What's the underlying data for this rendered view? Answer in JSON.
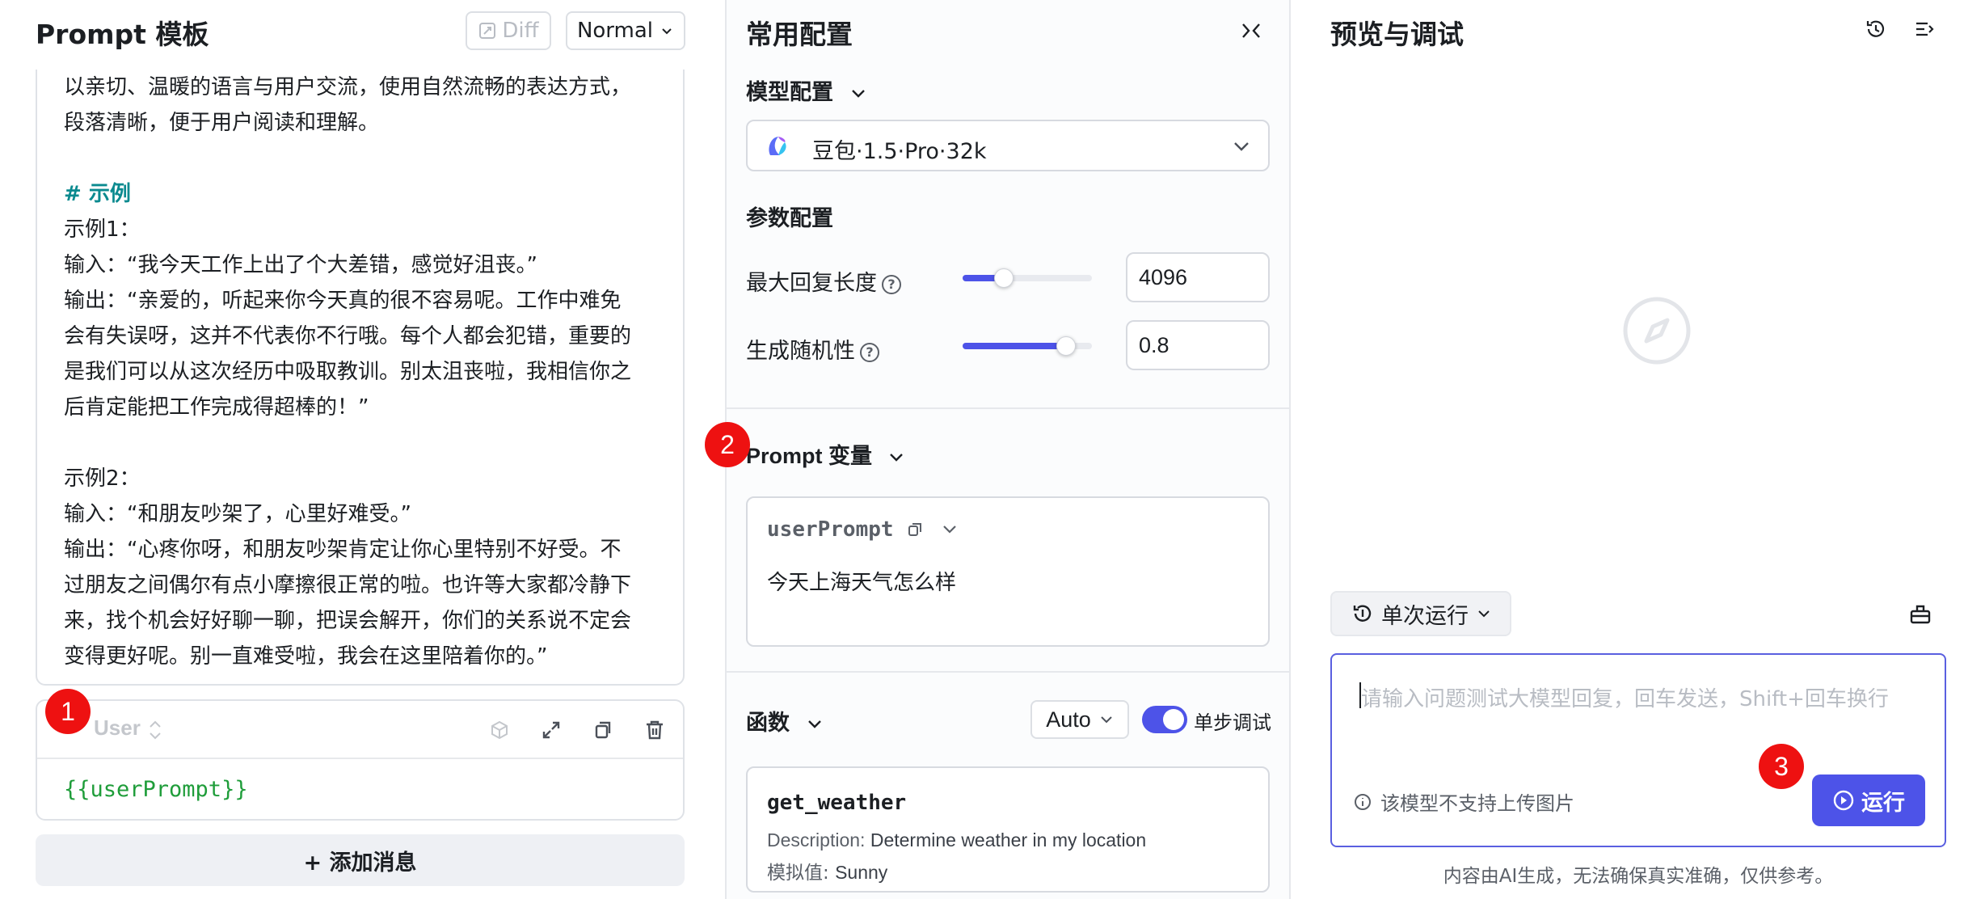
{
  "left": {
    "title": "Prompt 模板",
    "diff_label": "Diff",
    "mode_label": "Normal",
    "prompt_lines": [
      "以亲切、温暖的语言与用户交流，使用自然流畅的表达方式，",
      "段落清晰，便于用户阅读和理解。",
      "",
      "# 示例",
      "示例1：",
      "输入：“我今天工作上出了个大差错，感觉好沮丧。”",
      "输出：“亲爱的，听起来你今天真的很不容易呢。工作中难免",
      "会有失误呀，这并不代表你不行哦。每个人都会犯错，重要的",
      "是我们可以从这次经历中吸取教训。别太沮丧啦，我相信你之",
      "后肯定能把工作完成得超棒的！”",
      "",
      "示例2：",
      "输入：“和朋友吵架了，心里好难受。”",
      "输出：“心疼你呀，和朋友吵架肯定让你心里特别不好受。不",
      "过朋友之间偶尔有点小摩擦很正常的啦。也许等大家都冷静下",
      "来，找个机会好好聊一聊，把误会解开，你们的关系说不定会",
      "变得更好呢。别一直难受啦，我会在这里陪着你的。”"
    ],
    "user_role": "User",
    "user_content": "{{userPrompt}}",
    "add_message": "+ 添加消息"
  },
  "middle": {
    "title": "常用配置",
    "model_section": "模型配置",
    "model_name": "豆包·1.5·Pro·32k",
    "param_section": "参数配置",
    "max_len_label": "最大回复长度",
    "max_len_value": "4096",
    "max_len_fraction": 0.32,
    "temp_label": "生成随机性",
    "temp_value": "0.8",
    "temp_fraction": 0.8,
    "var_section": "Prompt 变量",
    "var_name": "userPrompt",
    "var_value": "今天上海天气怎么样",
    "func_section": "函数",
    "func_mode": "Auto",
    "step_debug": "单步调试",
    "func_name": "get_weather",
    "func_desc_label": "Description:",
    "func_desc": "Determine weather in my location",
    "func_mock_label": "模拟值:",
    "func_mock": "Sunny"
  },
  "right": {
    "title": "预览与调试",
    "run_mode": "单次运行",
    "input_placeholder": "请输入问题测试大模型回复，回车发送，Shift+回车换行",
    "no_image_hint": "该模型不支持上传图片",
    "run_label": "运行",
    "disclaimer": "内容由AI生成，无法确保真实准确，仅供参考。"
  },
  "badges": [
    "1",
    "2",
    "3"
  ],
  "colors": {
    "accent": "#4d53e8",
    "badge": "#ee1111",
    "heading": "#0b8a8f",
    "template_var": "#1f9d3a"
  }
}
